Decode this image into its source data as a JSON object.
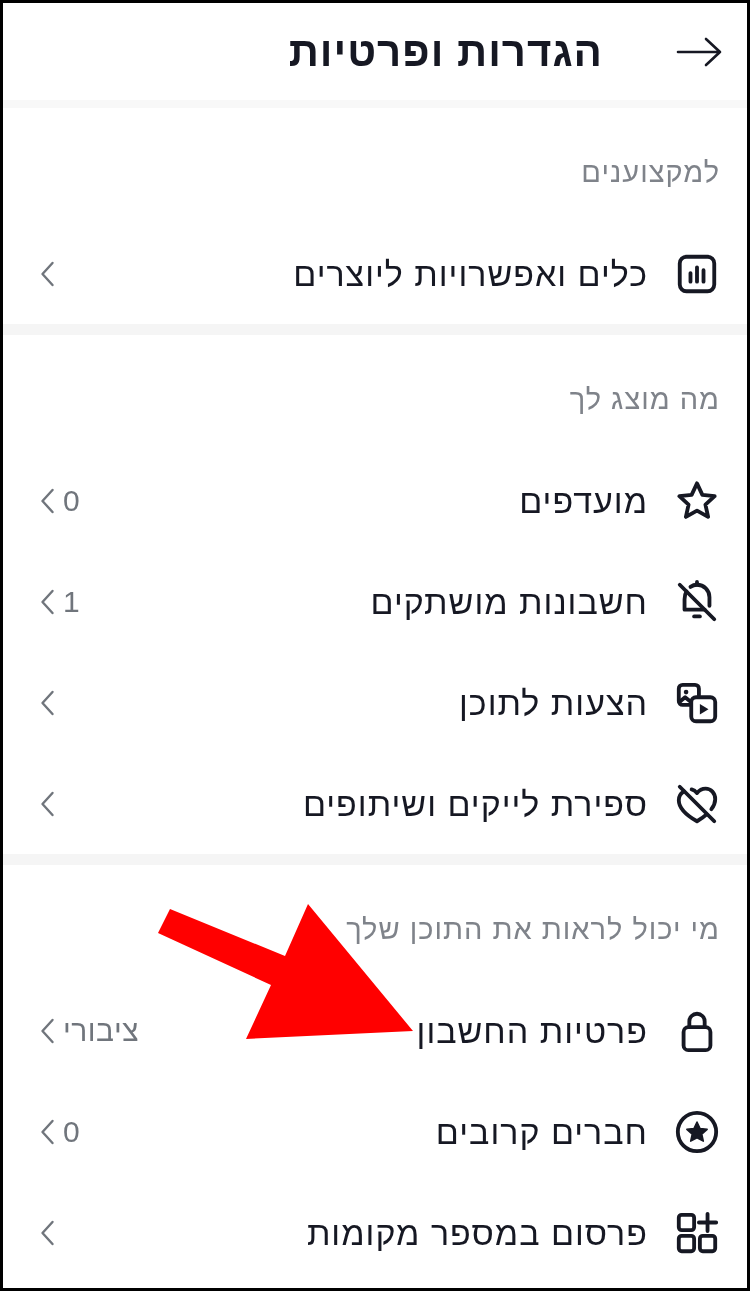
{
  "header": {
    "title": "הגדרות ופרטיות"
  },
  "sections": [
    {
      "title": "למקצוענים",
      "items": [
        {
          "kind": "creator_tools",
          "label": "כלים ואפשרויות ליוצרים",
          "marked_by_arrow": false
        }
      ]
    },
    {
      "title": "מה מוצג לך",
      "items": [
        {
          "kind": "favorites",
          "label": "מועדפים",
          "value": "0",
          "marked_by_arrow": false
        },
        {
          "kind": "muted",
          "label": "חשבונות מושתקים",
          "value": "1",
          "marked_by_arrow": false
        },
        {
          "kind": "content_preferences",
          "label": "הצעות לתוכן",
          "marked_by_arrow": false
        },
        {
          "kind": "like_count",
          "label": "ספירת לייקים ושיתופים",
          "marked_by_arrow": false
        }
      ]
    },
    {
      "title": "מי יכול לראות את התוכן שלך",
      "items": [
        {
          "kind": "privacy",
          "label": "פרטיות החשבון",
          "value": "ציבורי",
          "marked_by_arrow": true
        },
        {
          "kind": "close_friends",
          "label": "חברים קרובים",
          "value": "0",
          "marked_by_arrow": false
        },
        {
          "kind": "cross_posting",
          "label": "פרסום במספר מקומות",
          "marked_by_arrow": false
        }
      ]
    }
  ]
}
